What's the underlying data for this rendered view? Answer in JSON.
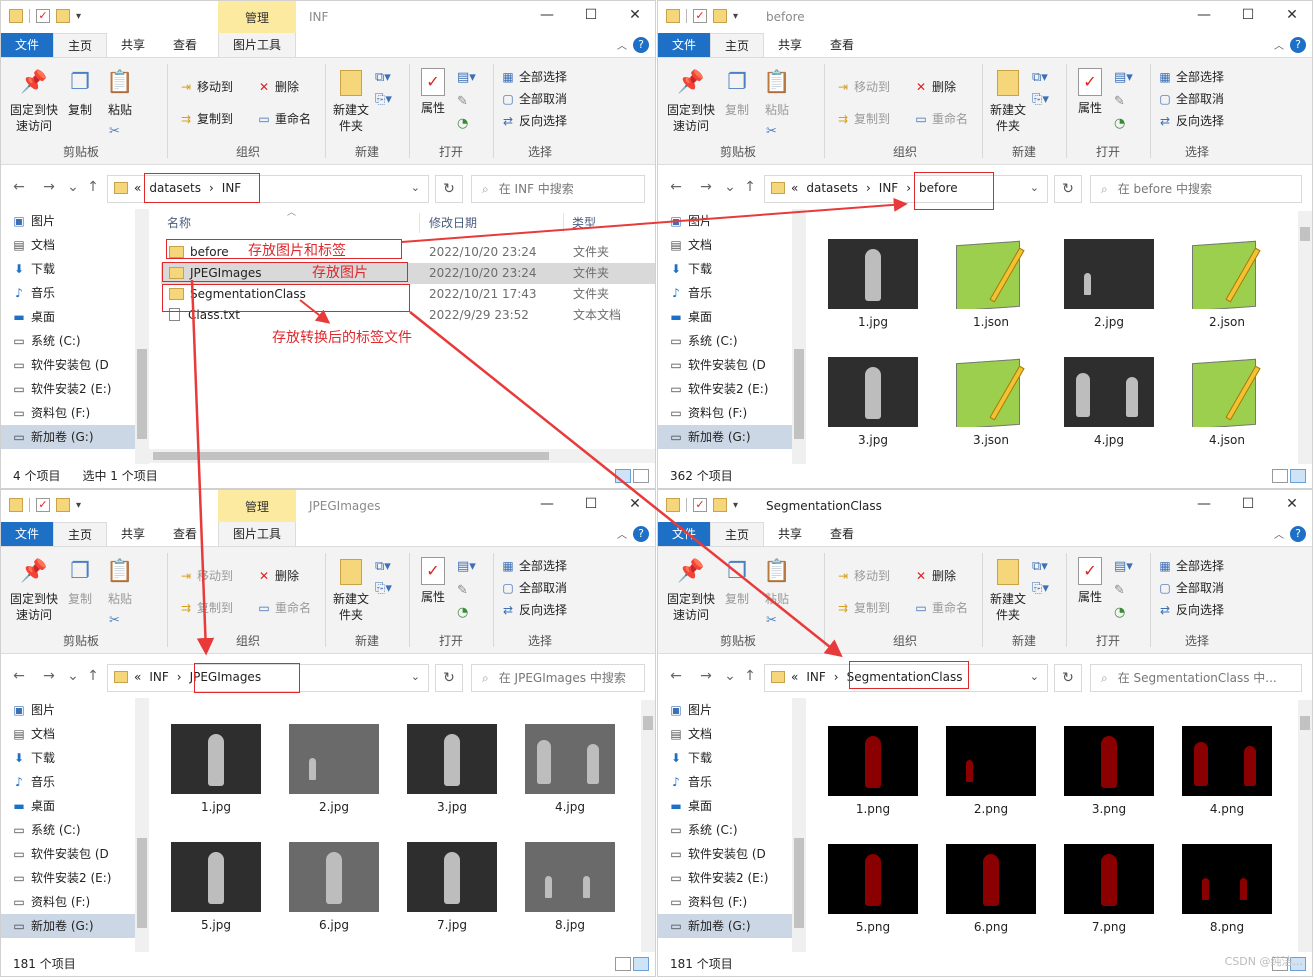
{
  "common": {
    "tab_file": "文件",
    "tab_home": "主页",
    "tab_share": "共享",
    "tab_view": "查看",
    "tab_picture_tools": "图片工具",
    "manage": "管理",
    "help": "?",
    "pin_label": "固定到快速访问",
    "copy": "复制",
    "paste": "粘贴",
    "move_to": "移动到",
    "copy_to": "复制到",
    "delete": "删除",
    "rename": "重命名",
    "new_folder": "新建文件夹",
    "properties": "属性",
    "select_all": "全部选择",
    "select_none": "全部取消",
    "invert": "反向选择",
    "grp_clipboard": "剪贴板",
    "grp_organize": "组织",
    "grp_new": "新建",
    "grp_open": "打开",
    "grp_select": "选择",
    "nav": [
      {
        "label": "图片",
        "icon": "picture-icon"
      },
      {
        "label": "文档",
        "icon": "document-icon"
      },
      {
        "label": "下载",
        "icon": "download-icon"
      },
      {
        "label": "音乐",
        "icon": "music-icon"
      },
      {
        "label": "桌面",
        "icon": "desktop-icon"
      },
      {
        "label": "系统 (C:)",
        "icon": "drive-icon"
      },
      {
        "label": "软件安装包 (D",
        "icon": "drive-icon"
      },
      {
        "label": "软件安装2 (E:)",
        "icon": "drive-icon"
      },
      {
        "label": "资料包 (F:)",
        "icon": "drive-icon"
      },
      {
        "label": "新加卷 (G:)",
        "icon": "drive-icon"
      }
    ]
  },
  "win_inf": {
    "title": "INF",
    "path": [
      "«",
      "datasets",
      "›",
      "INF"
    ],
    "search": "在 INF 中搜索",
    "col_name": "名称",
    "col_date": "修改日期",
    "col_type": "类型",
    "rows": [
      {
        "name": "before",
        "date": "2022/10/20 23:24",
        "type": "文件夹"
      },
      {
        "name": "JPEGImages",
        "date": "2022/10/20 23:24",
        "type": "文件夹"
      },
      {
        "name": "SegmentationClass",
        "date": "2022/10/21 17:43",
        "type": "文件夹"
      },
      {
        "name": "Class.txt",
        "date": "2022/9/29 23:52",
        "type": "文本文档"
      }
    ],
    "status_count": "4 个项目",
    "status_sel": "选中 1 个项目"
  },
  "win_before": {
    "title": "before",
    "path": [
      "«",
      "datasets",
      "›",
      "INF",
      "›",
      "before"
    ],
    "search": "在 before 中搜索",
    "items": [
      "1.jpg",
      "1.json",
      "2.jpg",
      "2.json",
      "3.jpg",
      "3.json",
      "4.jpg",
      "4.json"
    ],
    "status_count": "362 个项目"
  },
  "win_jpeg": {
    "title": "JPEGImages",
    "path": [
      "«",
      "INF",
      "›",
      "JPEGImages"
    ],
    "search": "在 JPEGImages 中搜索",
    "items": [
      "1.jpg",
      "2.jpg",
      "3.jpg",
      "4.jpg",
      "5.jpg",
      "6.jpg",
      "7.jpg",
      "8.jpg"
    ],
    "status_count": "181 个项目"
  },
  "win_seg": {
    "title": "SegmentationClass",
    "path": [
      "«",
      "INF",
      "›",
      "SegmentationClass"
    ],
    "search": "在 SegmentationClass 中...",
    "items": [
      "1.png",
      "2.png",
      "3.png",
      "4.png",
      "5.png",
      "6.png",
      "7.png",
      "8.png"
    ],
    "status_count": "181 个项目"
  },
  "annotations": {
    "before": "存放图片和标签",
    "jpeg": "存放图片",
    "seg": "存放转换后的标签文件"
  },
  "watermark": "CSDN @纯洁..."
}
